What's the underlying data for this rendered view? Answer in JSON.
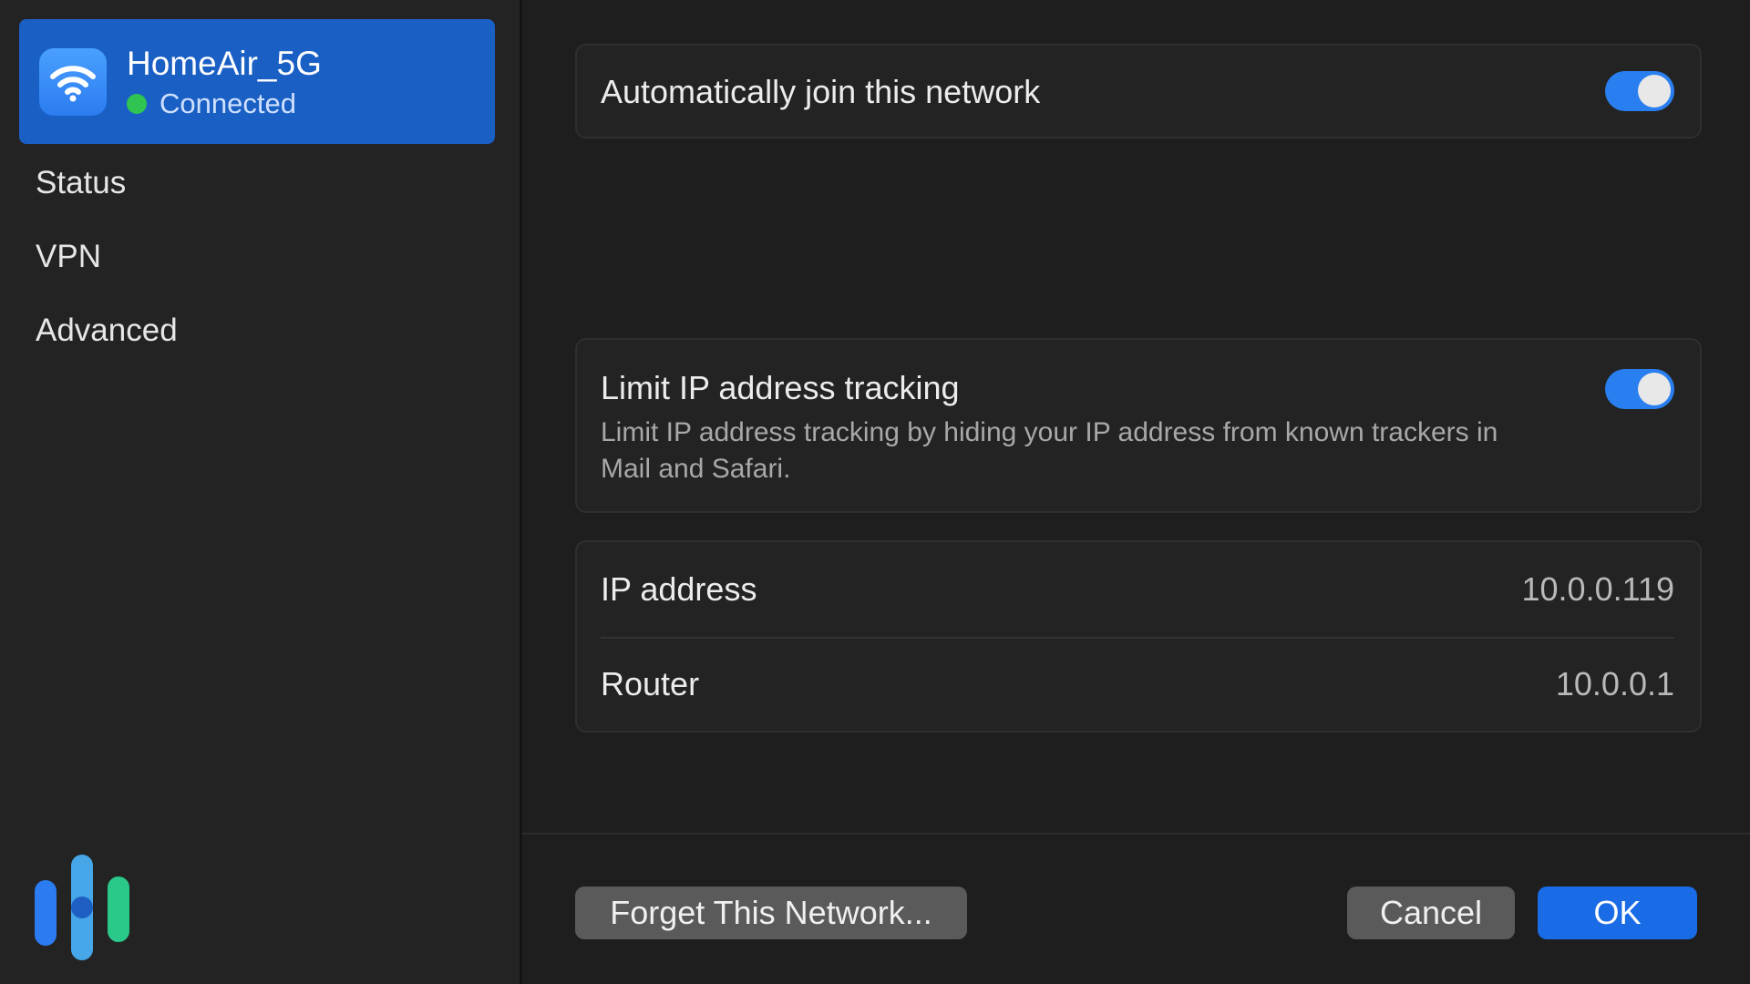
{
  "sidebar": {
    "network": {
      "name": "HomeAir_5G",
      "status": "Connected",
      "icon": "wifi-icon",
      "status_color": "#30c552"
    },
    "items": [
      {
        "label": "Status"
      },
      {
        "label": "VPN"
      },
      {
        "label": "Advanced"
      }
    ],
    "brand_logo": "brand-logo-icon"
  },
  "settings": {
    "auto_join": {
      "label": "Automatically join this network",
      "enabled": true
    },
    "limit_ip_tracking": {
      "label": "Limit IP address tracking",
      "description": "Limit IP address tracking by hiding your IP address from known trackers in Mail and Safari.",
      "enabled": true
    },
    "info": [
      {
        "label": "IP address",
        "value": "10.0.0.119"
      },
      {
        "label": "Router",
        "value": "10.0.0.1"
      }
    ]
  },
  "footer": {
    "forget_label": "Forget This Network...",
    "cancel_label": "Cancel",
    "ok_label": "OK"
  },
  "colors": {
    "accent": "#1a6be6",
    "selected_row": "#1a5fc4",
    "toggle_on": "#2a7ff0"
  }
}
